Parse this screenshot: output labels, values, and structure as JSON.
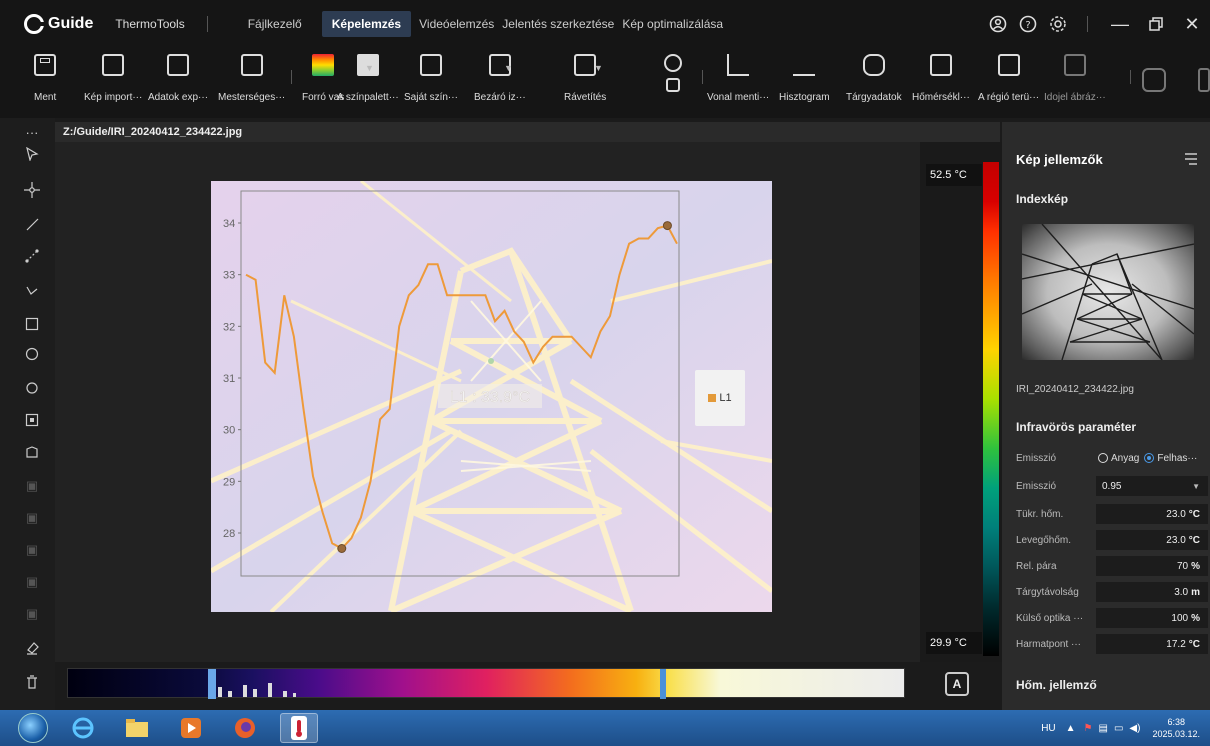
{
  "titlebar": {
    "logo": "Guide",
    "app_name": "ThermoTools",
    "menu": [
      "Fájlkezelő",
      "Képelemzés",
      "Videóelemzés",
      "Jelentés szerkeztése",
      "Kép optimalizálása"
    ],
    "active_menu": "Képelemzés"
  },
  "toolbar": {
    "items": [
      "Ment",
      "Kép import···",
      "Adatok exp···",
      "Mesterséges···",
      "Forró vas",
      "A színpalett···",
      "Saját szín···",
      "Bezáró iz···",
      "Rávetítés",
      "",
      "Vonal menti···",
      "Hisztogram",
      "Tárgyadatok",
      "Hőmérsékl···",
      "A régió terü···",
      "Idojel ábráz···",
      ""
    ]
  },
  "path": "Z:/Guide/IRI_20240412_234422.jpg",
  "plot": {
    "y_ticks": [
      "34",
      "33",
      "32",
      "31",
      "30",
      "29",
      "28"
    ],
    "label": "L1 : 33.9°C",
    "legend": "L1"
  },
  "chart_data": {
    "type": "line",
    "title": "",
    "xlabel": "",
    "ylabel": "",
    "ylim": [
      27.3,
      34.6
    ],
    "series": [
      {
        "name": "L1",
        "x": [
          0,
          1,
          2,
          3,
          4,
          5,
          6,
          7,
          8,
          9,
          10,
          11,
          12,
          13,
          14,
          15,
          16,
          17,
          18,
          19,
          20,
          21,
          22,
          23,
          24,
          25,
          26,
          27,
          28,
          29,
          30,
          31,
          32,
          33,
          34,
          35,
          36,
          37,
          38,
          39,
          40,
          41,
          42,
          43,
          44,
          45
        ],
        "values": [
          33.0,
          32.9,
          31.3,
          31.1,
          32.6,
          31.8,
          30.4,
          29.1,
          28.4,
          27.8,
          27.7,
          27.9,
          28.3,
          29.0,
          30.2,
          30.4,
          32.0,
          32.6,
          32.8,
          33.2,
          33.2,
          32.6,
          32.6,
          32.6,
          32.6,
          32.6,
          32.1,
          32.3,
          31.9,
          31.7,
          31.3,
          31.6,
          31.8,
          31.8,
          31.8,
          31.6,
          31.4,
          31.9,
          32.2,
          33.0,
          33.6,
          33.7,
          33.7,
          33.9,
          33.95,
          33.6
        ]
      }
    ]
  },
  "colorscale": {
    "max": "52.5 °C",
    "min": "29.9 °C"
  },
  "histogram": {
    "auto_button": "A"
  },
  "panel": {
    "title": "Kép jellemzők",
    "index_title": "Indexkép",
    "filename": "IRI_20240412_234422.jpg",
    "ir_title": "Infravörös paraméter",
    "emission_label": "Emisszió",
    "radio_material": "Anyag",
    "radio_user": "Felhas···",
    "emission_value": "0.95",
    "params": [
      {
        "label": "Tükr. hőm.",
        "value": "23.0",
        "unit": "°C"
      },
      {
        "label": "Levegőhőm.",
        "value": "23.0",
        "unit": "°C"
      },
      {
        "label": "Rel. pára",
        "value": "70",
        "unit": "%"
      },
      {
        "label": "Tárgytávolság",
        "value": "3.0",
        "unit": "m"
      },
      {
        "label": "Külső optika ···",
        "value": "100",
        "unit": "%"
      },
      {
        "label": "Harmatpont ···",
        "value": "17.2",
        "unit": "°C"
      }
    ],
    "hom_title": "Hőm. jellemző"
  },
  "taskbar": {
    "lang": "HU",
    "time": "6:38",
    "date": "2025.03.12."
  }
}
